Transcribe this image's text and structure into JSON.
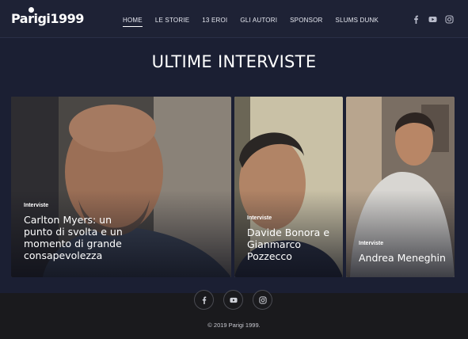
{
  "site": {
    "logo_text": "Parigi1999"
  },
  "nav": {
    "items": [
      {
        "label": "HOME",
        "active": true
      },
      {
        "label": "LE STORIE",
        "active": false
      },
      {
        "label": "13 EROI",
        "active": false
      },
      {
        "label": "GLI AUTORI",
        "active": false
      },
      {
        "label": "SPONSOR",
        "active": false
      },
      {
        "label": "SLUMS DUNK",
        "active": false
      }
    ]
  },
  "social": {
    "icons": [
      "facebook-icon",
      "youtube-icon",
      "instagram-icon"
    ]
  },
  "main": {
    "title": "ULTIME INTERVISTE",
    "cards": [
      {
        "category": "Interviste",
        "title": "Carlton Myers: un punto di svolta e un momento di grande consapevolezza"
      },
      {
        "category": "Interviste",
        "title": "Davide Bonora e Gianmarco Pozzecco"
      },
      {
        "category": "Interviste",
        "title": "Andrea Meneghin"
      }
    ]
  },
  "footer": {
    "copyright": "© 2019 Parigi 1999."
  },
  "colors": {
    "background": "#1b1f33",
    "header": "#1e2235",
    "footer": "#1a1a1d"
  }
}
